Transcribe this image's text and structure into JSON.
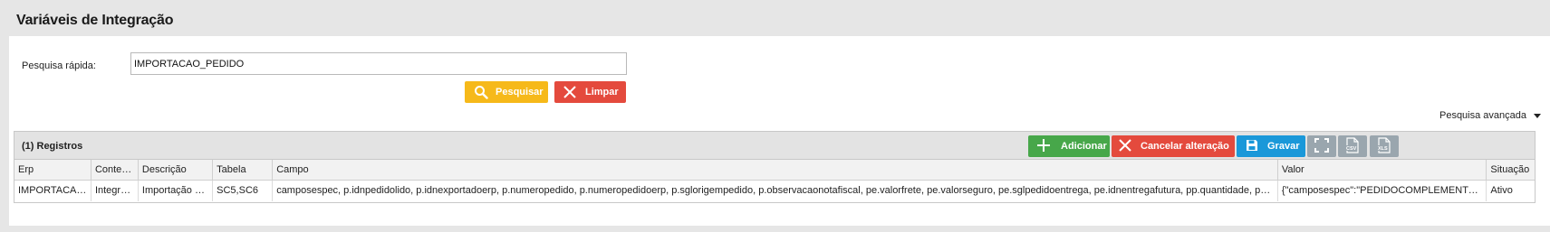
{
  "page": {
    "title": "Variáveis de Integração"
  },
  "search": {
    "label": "Pesquisa rápida:",
    "value": "IMPORTACAO_PEDIDO",
    "search_button": "Pesquisar",
    "clear_button": "Limpar",
    "advanced_label": "Pesquisa avançada"
  },
  "grid": {
    "count_label": "(1) Registros",
    "toolbar": {
      "add_label": "Adicionar",
      "cancel_label": "Cancelar alteração",
      "save_label": "Gravar",
      "expand_icon": "expand-icon",
      "csv_icon": "csv-file-icon",
      "xls_icon": "xls-file-icon"
    },
    "columns": [
      "Erp",
      "Contexto",
      "Descrição",
      "Tabela",
      "Campo",
      "Valor",
      "Situação"
    ],
    "rows": [
      [
        "IMPORTACAO_PEDIDO",
        "Integração",
        "Importação de pedido",
        "SC5,SC6",
        "camposespec, p.idnpedidolido, p.idnexportadoerp, p.numeropedido, p.numeropedidoerp, p.sglorigempedido, p.observacaonotafiscal, pe.valorfrete, pe.valorseguro, pe.sglpedidoentrega, pe.idnentregafutura, pp.quantidade, pp.quantidade",
        "{\"camposespec\":\"PEDIDOCOMPLEMENTOCAMPOS\"}",
        "Ativo"
      ]
    ]
  },
  "colors": {
    "yellow": "#f6b91a",
    "red": "#e44a3d",
    "green": "#47a74a",
    "blue": "#1a98d9",
    "gray": "#9aa6ae"
  }
}
